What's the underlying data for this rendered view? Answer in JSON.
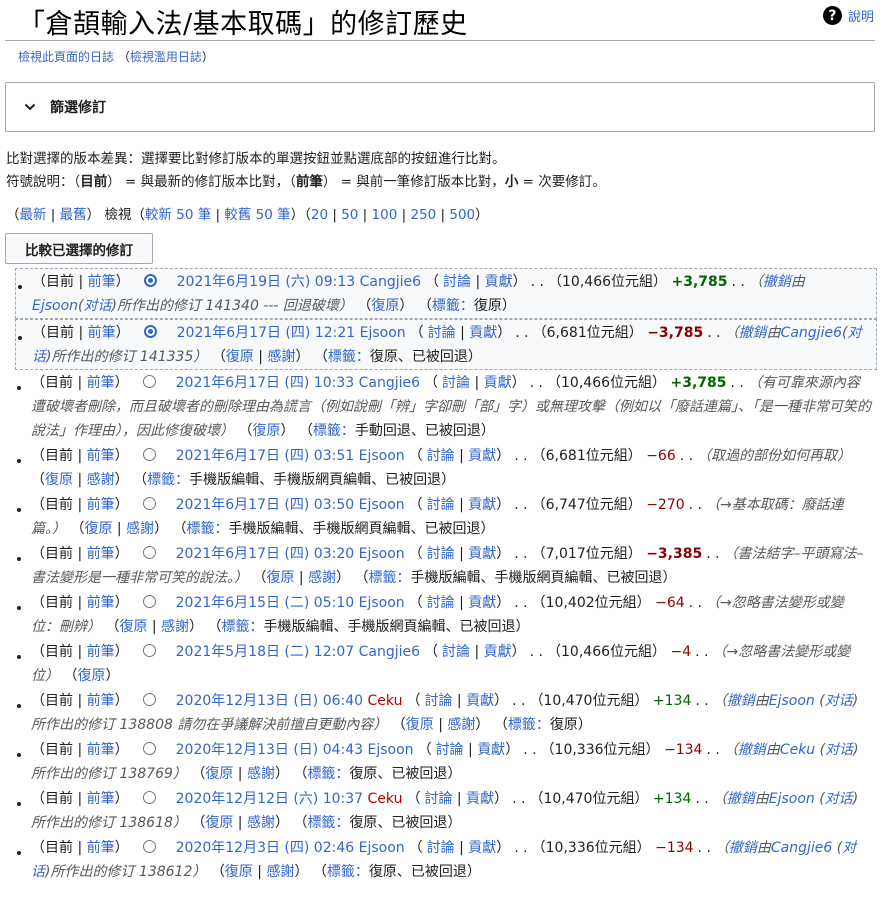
{
  "title": "「倉頡輸入法/基本取碼」的修訂歷史",
  "help_label": "說明",
  "sublinks": {
    "log": "檢視此頁面的日誌",
    "abuse": "檢視濫用日誌"
  },
  "filter_label": "篩選修訂",
  "info_line1": "比對選擇的版本差異：選擇要比對修訂版本的單選按鈕並點選底部的按鈕進行比對。",
  "info_line2": {
    "p1": "符號說明：（",
    "cur": "目前",
    "p2": "） = 與最新的修訂版本比對，（",
    "prev": "前筆",
    "p3": "） = 與前一筆修訂版本比對，",
    "minor": "小",
    "p4": " = 次要修訂。"
  },
  "nav": {
    "newest": "最新",
    "oldest": "最舊",
    "view": "檢視（",
    "newer": "較新 50 筆",
    "older": "較舊 50 筆",
    "n20": "20",
    "n50": "50",
    "n100": "100",
    "n250": "250",
    "n500": "500"
  },
  "compare_button": "比較已選擇的修訂",
  "common": {
    "cur": "目前",
    "prev": "前筆",
    "talk": "討論",
    "contribs": "貢獻",
    "undo": "復原",
    "thank": "感謝",
    "tags": "標籤："
  },
  "revisions": [
    {
      "date": "2021年6月19日 (六) 09:13",
      "user": "Cangjie6",
      "size": "10,466位元組",
      "diff": "+3,785",
      "diffclass": "pos",
      "c1": "撤銷",
      "c2": "由",
      "c3": "Ejsoon",
      "c4": "(",
      "c5": "对话",
      "c6": ")所作出的修订 141340 --- 回退破壞）"
    },
    {
      "date": "2021年6月17日 (四) 12:21",
      "user": "Ejsoon",
      "size": "6,681位元組",
      "diff": "−3,785",
      "diffclass": "neg",
      "c1": "撤銷",
      "c2": "由",
      "c3": "Cangjie6",
      "c4": "(",
      "c5": "对话",
      "c6": ")所作出的修订 141335）"
    },
    {
      "date": "2021年6月17日 (四) 10:33",
      "user": "Cangjie6",
      "size": "10,466位元組",
      "diff": "+3,785",
      "diffclass": "pos",
      "comment": "（有可靠來源內容遭破壞者刪除，而且破壞者的刪除理由為謊言（例如說刪「辨」字卻刪「部」字）或無理攻擊（例如以「廢話連篇」、「是一種非常可笑的說法」作理由），因此修復破壞）"
    },
    {
      "date": "2021年6月17日 (四) 03:51",
      "user": "Ejsoon",
      "size": "6,681位元組",
      "diff": "−66",
      "diffclass": "negn",
      "comment": "（取過的部份如何再取）"
    },
    {
      "date": "2021年6月17日 (四) 03:50",
      "user": "Ejsoon",
      "size": "6,747位元組",
      "diff": "−270",
      "diffclass": "negn",
      "comment": "（→基本取碼：廢話連篇。）"
    },
    {
      "date": "2021年6月17日 (四) 03:20",
      "user": "Ejsoon",
      "size": "7,017位元組",
      "diff": "−3,385",
      "diffclass": "neg",
      "comment": "（書法結字–平頭寫法–書法變形是一種非常可笑的說法。）"
    },
    {
      "date": "2021年6月15日 (二) 05:10",
      "user": "Ejsoon",
      "size": "10,402位元組",
      "diff": "−64",
      "diffclass": "negn",
      "comment": "（→忽略書法變形或變位：刪辨）"
    },
    {
      "date": "2021年5月18日 (二) 12:07",
      "user": "Cangjie6",
      "size": "10,466位元組",
      "diff": "−4",
      "diffclass": "negn",
      "comment": "（→忽略書法變形或變位）"
    },
    {
      "date": "2020年12月13日 (日) 06:40",
      "user": "Ceku",
      "size": "10,470位元組",
      "diff": "+134",
      "diffclass": "posn",
      "c1": "撤銷",
      "c2": "由",
      "c3": "Ejsoon",
      "c4": " (",
      "c5": "对话",
      "c6": ")所作出的修订 138808 請勿在爭議解決前擅自更動內容）"
    },
    {
      "date": "2020年12月13日 (日) 04:43",
      "user": "Ejsoon",
      "size": "10,336位元組",
      "diff": "−134",
      "diffclass": "negn",
      "c1": "撤銷",
      "c2": "由",
      "c3": "Ceku",
      "c4": " (",
      "c5": "对话",
      "c6": ")所作出的修订 138769）"
    },
    {
      "date": "2020年12月12日 (六) 10:37",
      "user": "Ceku",
      "size": "10,470位元組",
      "diff": "+134",
      "diffclass": "posn",
      "c1": "撤銷",
      "c2": "由",
      "c3": "Ejsoon",
      "c4": " (",
      "c5": "对话",
      "c6": ")所作出的修订 138618）"
    },
    {
      "date": "2020年12月3日 (四) 02:46",
      "user": "Ejsoon",
      "size": "10,336位元組",
      "diff": "−134",
      "diffclass": "negn",
      "c1": "撤銷",
      "c2": "由",
      "c3": "Cangjie6",
      "c4": " (",
      "c5": "对话",
      "c6": ")所作出的修订 138612）"
    }
  ],
  "row_tags": [
    {
      "undo": true,
      "thank": false,
      "tags": "復原"
    },
    {
      "undo": true,
      "thank": true,
      "tags": "復原、已被回退"
    },
    {
      "undo": true,
      "thank": false,
      "tags": "手動回退、已被回退"
    },
    {
      "undo": true,
      "thank": true,
      "tags": "手機版編輯、手機版網頁編輯、已被回退"
    },
    {
      "undo": true,
      "thank": true,
      "tags": "手機版編輯、手機版網頁編輯、已被回退"
    },
    {
      "undo": true,
      "thank": true,
      "tags": "手機版編輯、手機版網頁編輯、已被回退"
    },
    {
      "undo": true,
      "thank": true,
      "tags": "手機版編輯、手機版網頁編輯、已被回退"
    },
    {
      "undo": true,
      "thank": false,
      "tags": ""
    },
    {
      "undo": true,
      "thank": true,
      "tags": "復原"
    },
    {
      "undo": true,
      "thank": true,
      "tags": "復原、已被回退"
    },
    {
      "undo": true,
      "thank": true,
      "tags": "復原、已被回退"
    },
    {
      "undo": true,
      "thank": true,
      "tags": "復原、已被回退"
    }
  ],
  "colors": {
    "link": "#3366cc",
    "redlink": "#ba0000",
    "positive": "#006400",
    "negative": "#8b0000"
  }
}
